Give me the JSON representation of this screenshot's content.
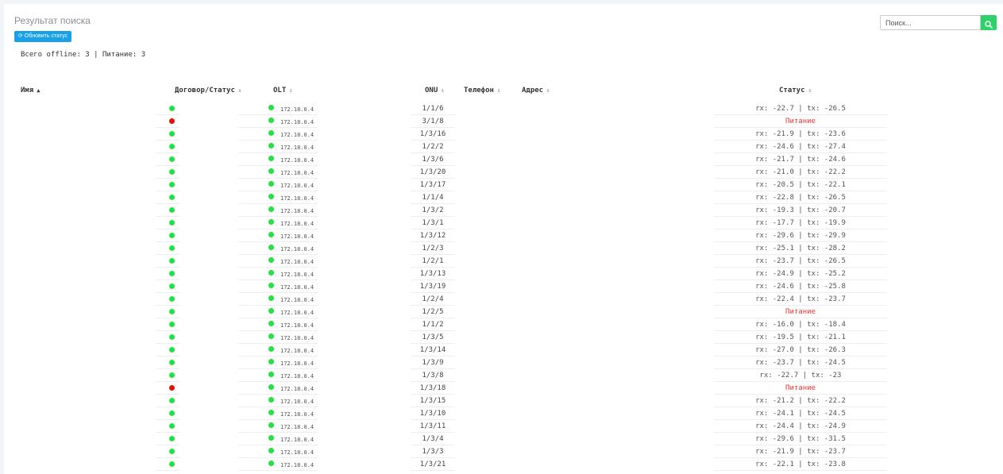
{
  "colors": {
    "online": "#22e04a",
    "offline": "#e01010",
    "power_text": "#ee3333",
    "accent_blue": "#1aa0e6",
    "accent_green": "#2fd26a"
  },
  "header": {
    "title": "Результат поиска",
    "refresh_label": "⟳ Обновить статус"
  },
  "search": {
    "placeholder": "Поиск..."
  },
  "summary": "Всего offline: 3 | Питание: 3",
  "columns": {
    "name": "Имя",
    "contract": "Договор/Статус",
    "olt": "OLT",
    "onu": "ONU",
    "phone": "Телефон",
    "address": "Адрес",
    "status": "Статус"
  },
  "rows": [
    {
      "online": true,
      "olt": "172.18.0.4",
      "onu": "1/1/6",
      "status": "rx: -22.7 | tx: -26.5"
    },
    {
      "online": false,
      "olt": "172.18.0.4",
      "onu": "3/1/8",
      "status": "Питание"
    },
    {
      "online": true,
      "olt": "172.18.0.4",
      "onu": "1/3/16",
      "status": "rx: -21.9 | tx: -23.6"
    },
    {
      "online": true,
      "olt": "172.18.0.4",
      "onu": "1/2/2",
      "status": "rx: -24.6 | tx: -27.4"
    },
    {
      "online": true,
      "olt": "172.18.0.4",
      "onu": "1/3/6",
      "status": "rx: -21.7 | tx: -24.6"
    },
    {
      "online": true,
      "olt": "172.18.0.4",
      "onu": "1/3/20",
      "status": "rx: -21.0 | tx: -22.2"
    },
    {
      "online": true,
      "olt": "172.18.0.4",
      "onu": "1/3/17",
      "status": "rx: -20.5 | tx: -22.1"
    },
    {
      "online": true,
      "olt": "172.18.0.4",
      "onu": "1/1/4",
      "status": "rx: -22.8 | tx: -26.5"
    },
    {
      "online": true,
      "olt": "172.18.0.4",
      "onu": "1/3/2",
      "status": "rx: -19.3 | tx: -20.7"
    },
    {
      "online": true,
      "olt": "172.18.0.4",
      "onu": "1/3/1",
      "status": "rx: -17.7 | tx: -19.9"
    },
    {
      "online": true,
      "olt": "172.18.0.4",
      "onu": "1/3/12",
      "status": "rx: -29.6 | tx: -29.9"
    },
    {
      "online": true,
      "olt": "172.18.0.4",
      "onu": "1/2/3",
      "status": "rx: -25.1 | tx: -28.2"
    },
    {
      "online": true,
      "olt": "172.18.0.4",
      "onu": "1/2/1",
      "status": "rx: -23.7 | tx: -26.5"
    },
    {
      "online": true,
      "olt": "172.18.0.4",
      "onu": "1/3/13",
      "status": "rx: -24.9 | tx: -25.2"
    },
    {
      "online": true,
      "olt": "172.18.0.4",
      "onu": "1/3/19",
      "status": "rx: -24.6 | tx: -25.8"
    },
    {
      "online": true,
      "olt": "172.18.0.4",
      "onu": "1/2/4",
      "status": "rx: -22.4 | tx: -23.7"
    },
    {
      "online": true,
      "olt": "172.18.0.4",
      "onu": "1/2/5",
      "status": "Питание"
    },
    {
      "online": true,
      "olt": "172.18.0.4",
      "onu": "1/1/2",
      "status": "rx: -16.0 | tx: -18.4"
    },
    {
      "online": true,
      "olt": "172.18.0.4",
      "onu": "1/3/5",
      "status": "rx: -19.5 | tx: -21.1"
    },
    {
      "online": true,
      "olt": "172.18.0.4",
      "onu": "1/3/14",
      "status": "rx: -27.0 | tx: -26.3"
    },
    {
      "online": true,
      "olt": "172.18.0.4",
      "onu": "1/3/9",
      "status": "rx: -23.7 | tx: -24.5"
    },
    {
      "online": true,
      "olt": "172.18.0.4",
      "onu": "1/3/8",
      "status": "rx: -22.7 | tx: -23"
    },
    {
      "online": false,
      "olt": "172.18.0.4",
      "onu": "1/3/18",
      "status": "Питание"
    },
    {
      "online": true,
      "olt": "172.18.0.4",
      "onu": "1/3/15",
      "status": "rx: -21.2 | tx: -22.2"
    },
    {
      "online": true,
      "olt": "172.18.0.4",
      "onu": "1/3/10",
      "status": "rx: -24.1 | tx: -24.5"
    },
    {
      "online": true,
      "olt": "172.18.0.4",
      "onu": "1/3/11",
      "status": "rx: -24.4 | tx: -24.9"
    },
    {
      "online": true,
      "olt": "172.18.0.4",
      "onu": "1/3/4",
      "status": "rx: -29.6 | tx: -31.5"
    },
    {
      "online": true,
      "olt": "172.18.0.4",
      "onu": "1/3/3",
      "status": "rx: -21.9 | tx: -23.7"
    },
    {
      "online": true,
      "olt": "172.18.0.4",
      "onu": "1/3/21",
      "status": "rx: -22.1 | tx: -23.8"
    }
  ]
}
